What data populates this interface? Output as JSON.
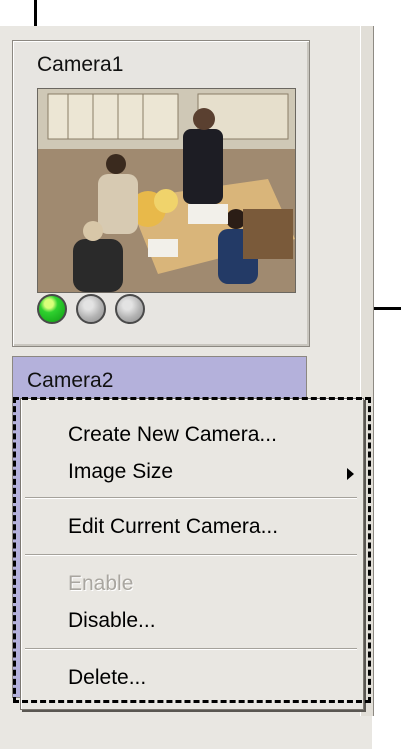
{
  "cameras": [
    {
      "name": "Camera1",
      "status_indicators": [
        "green-led-icon",
        "gray-led-icon",
        "gray-led-icon"
      ]
    },
    {
      "name": "Camera2"
    }
  ],
  "context_menu": {
    "items": [
      {
        "label": "Create New Camera...",
        "enabled": true
      },
      {
        "label": "Image Size",
        "enabled": true,
        "has_submenu": true
      },
      {
        "label": "Edit Current Camera...",
        "enabled": true
      },
      {
        "label": "Enable",
        "enabled": false
      },
      {
        "label": "Disable...",
        "enabled": true
      },
      {
        "label": "Delete...",
        "enabled": true
      }
    ]
  },
  "colors": {
    "panel_bg": "#e9e7e2",
    "selected_tile": "#b4b1db",
    "status_green": "#2fd12f",
    "status_gray": "#b4b4b4"
  }
}
